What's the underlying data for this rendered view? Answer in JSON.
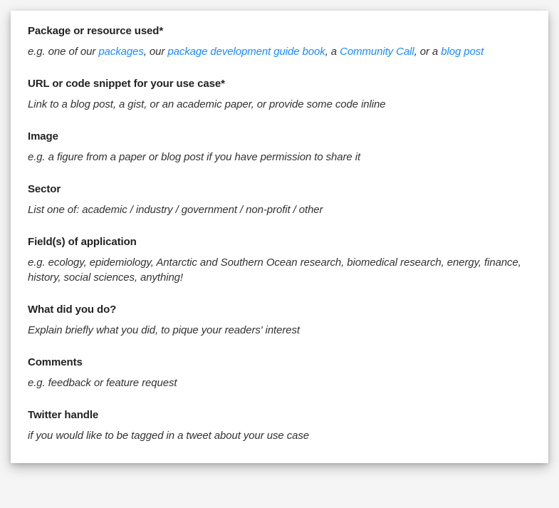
{
  "sections": [
    {
      "heading": "Package or resource used*",
      "description_parts": [
        {
          "type": "text",
          "value": "e.g. one of our "
        },
        {
          "type": "link",
          "value": "packages"
        },
        {
          "type": "text",
          "value": ", our "
        },
        {
          "type": "link",
          "value": "package development guide book"
        },
        {
          "type": "text",
          "value": ", a "
        },
        {
          "type": "link",
          "value": "Community Call"
        },
        {
          "type": "text",
          "value": ", or a "
        },
        {
          "type": "link",
          "value": "blog post"
        }
      ]
    },
    {
      "heading": "URL or code snippet for your use case*",
      "description": "Link to a blog post, a gist, or an academic paper, or provide some code inline"
    },
    {
      "heading": "Image",
      "description": "e.g. a figure from a paper or blog post if you have permission to share it"
    },
    {
      "heading": "Sector",
      "description": "List one of: academic / industry / government / non-profit / other"
    },
    {
      "heading": "Field(s) of application",
      "description": "e.g. ecology, epidemiology, Antarctic and Southern Ocean research, biomedical research, energy, finance, history, social sciences, anything!"
    },
    {
      "heading": "What did you do?",
      "description": "Explain briefly what you did, to pique your readers' interest"
    },
    {
      "heading": "Comments",
      "description": "e.g. feedback or feature request"
    },
    {
      "heading": "Twitter handle",
      "description": "if you would like to be tagged in a tweet about your use case"
    }
  ]
}
